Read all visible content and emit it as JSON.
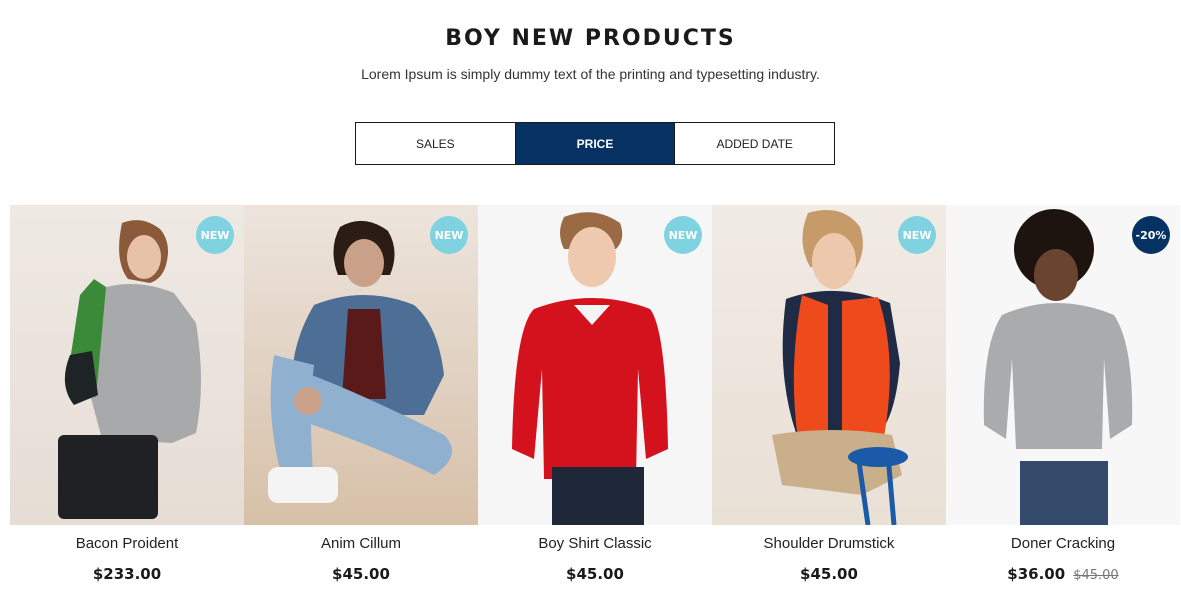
{
  "header": {
    "title": "BOY NEW PRODUCTS",
    "subtitle": "Lorem Ipsum is simply dummy text of the printing and typesetting industry."
  },
  "tabs": [
    {
      "label": "SALES",
      "active": false
    },
    {
      "label": "PRICE",
      "active": true
    },
    {
      "label": "ADDED DATE",
      "active": false
    }
  ],
  "colors": {
    "accent": "#053263",
    "new_badge": "#7fd3e1"
  },
  "products": [
    {
      "name": "Bacon Proident",
      "price": "$233.00",
      "old_price": "",
      "badge": "NEW",
      "badge_type": "new",
      "image_icon": "boy-gray-polo-photo"
    },
    {
      "name": "Anim Cillum",
      "price": "$45.00",
      "old_price": "",
      "badge": "NEW",
      "badge_type": "new",
      "image_icon": "boy-denim-jacket-photo"
    },
    {
      "name": "Boy Shirt Classic",
      "price": "$45.00",
      "old_price": "",
      "badge": "NEW",
      "badge_type": "new",
      "image_icon": "boy-red-sweater-photo"
    },
    {
      "name": "Shoulder Drumstick",
      "price": "$45.00",
      "old_price": "",
      "badge": "NEW",
      "badge_type": "new",
      "image_icon": "boy-orange-vest-photo"
    },
    {
      "name": "Doner Cracking",
      "price": "$36.00",
      "old_price": "$45.00",
      "badge": "-20%",
      "badge_type": "sale",
      "image_icon": "boy-gray-shirt-photo"
    }
  ]
}
